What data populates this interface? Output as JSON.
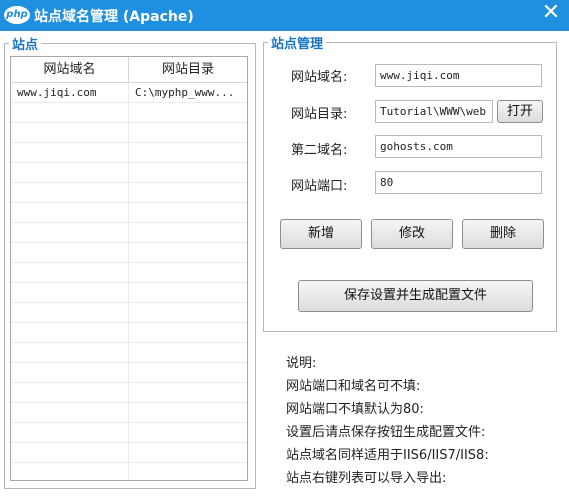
{
  "window": {
    "icon_text": "php",
    "title": "站点域名管理 (Apache)",
    "close_glyph": "✕"
  },
  "sites_group": {
    "legend": "站点",
    "columns": [
      "网站域名",
      "网站目录"
    ],
    "rows": [
      {
        "domain": "www.jiqi.com",
        "directory": "C:\\myphp_www..."
      }
    ]
  },
  "manage_group": {
    "legend": "站点管理",
    "domain_label": "网站域名:",
    "domain_value": "www.jiqi.com",
    "directory_label": "网站目录:",
    "directory_value": "Tutorial\\WWW\\web",
    "open_button": "打开",
    "second_domain_label": "第二域名:",
    "second_domain_value": "gohosts.com",
    "port_label": "网站端口:",
    "port_value": "80",
    "add_button": "新增",
    "edit_button": "修改",
    "delete_button": "删除",
    "save_button": "保存设置并生成配置文件"
  },
  "notes": {
    "heading": "说明:",
    "lines": [
      "网站端口和域名可不填:",
      "网站端口不填默认为80:",
      "设置后请点保存按钮生成配置文件:",
      "站点域名同样适用于IIS6/IIS7/IIS8:",
      "站点右键列表可以导入导出:"
    ]
  },
  "colors": {
    "titlebar": "#1f8fe0",
    "legend": "#1a74c6"
  }
}
